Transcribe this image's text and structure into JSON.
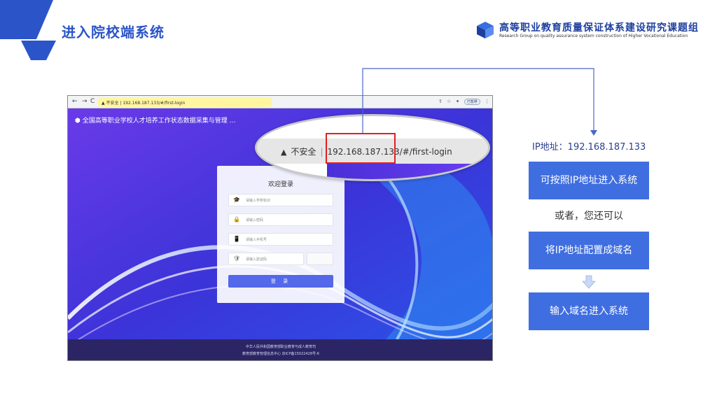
{
  "slide": {
    "title": "进入院校端系统",
    "org_name": "高等职业教育质量保证体系建设研究课题组",
    "org_name_en": "Research Group on quality assurance system construction of Higher Vocational Education"
  },
  "browser": {
    "nav_back": "←",
    "nav_forward": "→",
    "nav_reload": "C",
    "url_text": "▲ 不安全 | 192.168.187.133/#/first-login",
    "sync_badge": "已暂停",
    "site_title": "全国高等职业学校人才培养工作状态数据采集与管理 …",
    "login": {
      "title": "欢迎登录",
      "fields": [
        {
          "icon": "🎓",
          "placeholder": "请输入学校标识"
        },
        {
          "icon": "🔒",
          "placeholder": "请输入密码"
        },
        {
          "icon": "📱",
          "placeholder": "请输入手机号"
        },
        {
          "icon": "🛡",
          "placeholder": "请输入验证码"
        }
      ],
      "button": "登 录"
    },
    "footer": {
      "line1": "中华人民共和国教育部职业教育与成人教育司",
      "line2": "教育部教育管理信息中心   京ICP备15022428号-6"
    }
  },
  "magnifier": {
    "warning": "▲",
    "insecure": "不安全",
    "ip": "192.168.187.133",
    "path": "/#/first-login"
  },
  "steps": {
    "ip_label": "IP地址：192.168.187.133",
    "step1": "可按照IP地址进入系统",
    "or_text": "或者，您还可以",
    "step2": "将IP地址配置成域名",
    "step3": "输入域名进入系统"
  },
  "colors": {
    "brand_blue": "#2b54c8",
    "step_blue": "#3f6ee0",
    "highlight_red": "#e02020",
    "connector": "#4a66c8"
  }
}
